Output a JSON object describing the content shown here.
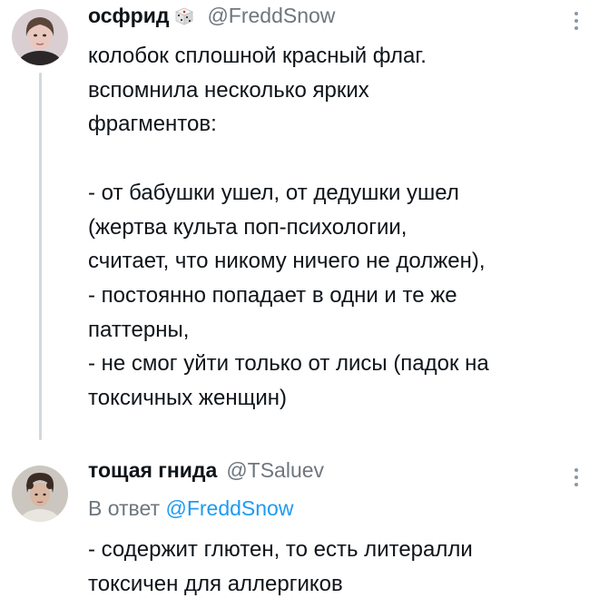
{
  "tweets": [
    {
      "display_name": "осфрид",
      "emoji_icon": "game-die-icon",
      "handle": "@FreddSnow",
      "text": "колобок сплошной красный флаг.\nвспомнила несколько ярких\nфрагментов:\n\n- от бабушки ушел, от дедушки ушел\n(жертва культа поп-психологии,\nсчитает, что никому ничего не должен),\n- постоянно попадает в одни и те же\nпаттерны,\n- не смог уйти только от лисы (падок на\nтоксичных женщин)"
    },
    {
      "display_name": "тощая гнида",
      "handle": "@TSaluev",
      "reply_prefix": "В ответ",
      "reply_mention": "@FreddSnow",
      "text": "- содержит глютен, то есть литералли\nтоксичен для аллергиков"
    }
  ],
  "colors": {
    "text": "#0f1419",
    "secondary": "#6e767d",
    "link": "#1d9bf0",
    "thread_line": "#cfd9de"
  }
}
